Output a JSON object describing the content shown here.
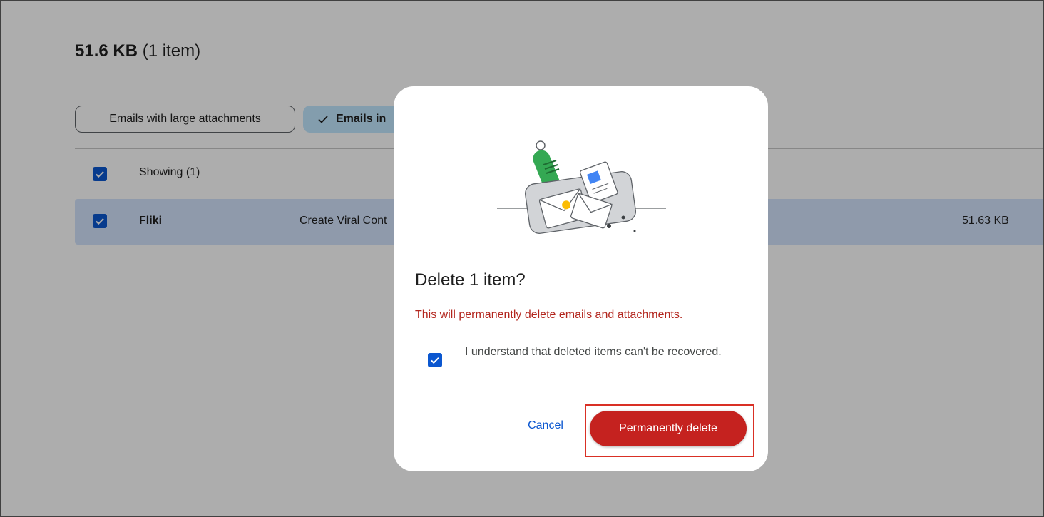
{
  "summary": {
    "size": "51.6 KB",
    "count": "(1 item)"
  },
  "filters": [
    {
      "label": "Emails with large attachments",
      "selected": false
    },
    {
      "label": "Emails in",
      "selected": true
    }
  ],
  "list": {
    "header_label": "Showing (1)",
    "rows": [
      {
        "sender": "Fliki",
        "subject": "Create Viral Cont",
        "size": "51.63 KB",
        "checked": true
      }
    ]
  },
  "dialog": {
    "title": "Delete 1 item?",
    "warning": "This will permanently delete emails and attachments.",
    "confirm_label": "I understand that deleted items can't be recovered.",
    "confirm_checked": true,
    "cancel_label": "Cancel",
    "delete_label": "Permanently delete"
  },
  "colors": {
    "accent_blue": "#0b57d0",
    "danger_red": "#c5221f",
    "selected_row": "#d3e3fd",
    "selected_chip": "#c2e7ff",
    "warning_text": "#b3261e"
  },
  "icons": [
    "checkmark-icon",
    "checkbox-checked-icon",
    "delete-illustration"
  ]
}
